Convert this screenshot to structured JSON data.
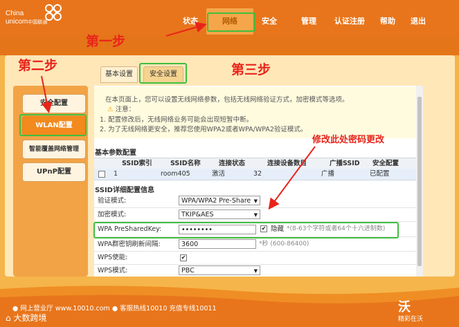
{
  "brand": {
    "name_line1": "China",
    "name_line2": "unicom",
    "name_cn": "中国联通"
  },
  "nav": [
    {
      "label": "状态",
      "active": false
    },
    {
      "label": "网络",
      "active": true
    },
    {
      "label": "安全",
      "active": false
    },
    {
      "label": "管理",
      "active": false
    },
    {
      "label": "认证注册",
      "active": false
    },
    {
      "label": "帮助",
      "active": false
    },
    {
      "label": "退出",
      "active": false
    }
  ],
  "sidebar": [
    {
      "label": "安全配置",
      "active": false
    },
    {
      "label": "WLAN配置",
      "active": true
    },
    {
      "label": "智能覆盖网络管理",
      "active": false
    },
    {
      "label": "UPnP配置",
      "active": false
    }
  ],
  "tabs": [
    {
      "label": "基本设置",
      "active": false
    },
    {
      "label": "安全设置",
      "active": true
    }
  ],
  "notice": {
    "intro": "在本页面上，您可以设置无线网络参数，包括无线网络验证方式，加密模式等选项。",
    "caution_title": "注意：",
    "line1": "1. 配置修改后，无线网络业务可能会出现短暂中断。",
    "line2": "2. 为了无线网络更安全，推荐您使用WPA2或者WPA/WPA2验证模式。"
  },
  "basic_section": {
    "title": "基本参数配置",
    "headers": [
      "SSID索引",
      "SSID名称",
      "连接状态",
      "连接设备数目",
      "广播SSID",
      "安全配置"
    ],
    "row": [
      "1",
      "room405",
      "激活",
      "32",
      "广播",
      "已配置"
    ]
  },
  "detail_section": {
    "title": "SSID详细配置信息",
    "auth_label": "验证模式:",
    "auth_value": "WPA/WPA2 Pre-Share",
    "enc_label": "加密模式:",
    "enc_value": "TKIP&AES",
    "psk_label": "WPA PreSharedKey:",
    "psk_value": "••••••••",
    "hide_label": "隐藏",
    "psk_hint": "*(8-63个字符或者64个十六进制数)",
    "interval_label": "WPA群密钥刷新间隔:",
    "interval_value": "3600",
    "interval_hint": "*秒 (600-86400)",
    "wps_enable_label": "WPS使能:",
    "wps_mode_label": "WPS模式:",
    "wps_mode_value": "PBC"
  },
  "annotations": {
    "step1": "第一步",
    "step2": "第二步",
    "step3": "第三步",
    "note": "修改此处密码更改"
  },
  "footer": {
    "text": "● 网上营业厅  www.10010.com  ● 客服热线10010  充值专线10011",
    "watermark": "大数跨境",
    "wo": "精彩在沃"
  },
  "colors": {
    "header": "#e8751b",
    "annotation_red": "#e8241a",
    "highlight_green": "#3fbf3f"
  }
}
